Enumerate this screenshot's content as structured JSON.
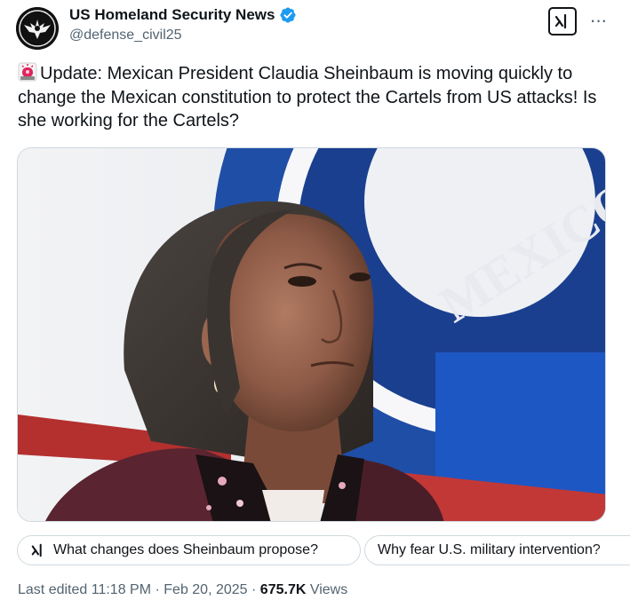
{
  "author": {
    "display_name": "US Homeland Security News",
    "handle": "@defense_civil25",
    "verified": true
  },
  "tweet": {
    "emoji": "siren-icon",
    "text": "Update: Mexican President Claudia Sheinbaum is moving quickly to change the Mexican constitution to protect the Cartels from US attacks! Is she working for the Cartels?"
  },
  "media": {
    "sign_text": "MEXICO"
  },
  "grok_prompts": [
    {
      "label": "What changes does Sheinbaum propose?"
    },
    {
      "label": "Why fear U.S. military intervention?"
    }
  ],
  "meta": {
    "edited_prefix": "Last edited",
    "time": "11:18 PM",
    "separator": "·",
    "date": "Feb 20, 2025",
    "views_count": "675.7K",
    "views_label": "Views"
  },
  "colors": {
    "verified": "#1d9bf0",
    "text_primary": "#0f1419",
    "text_secondary": "#536471",
    "border": "#cfd9de",
    "siren": "#e0245e"
  }
}
